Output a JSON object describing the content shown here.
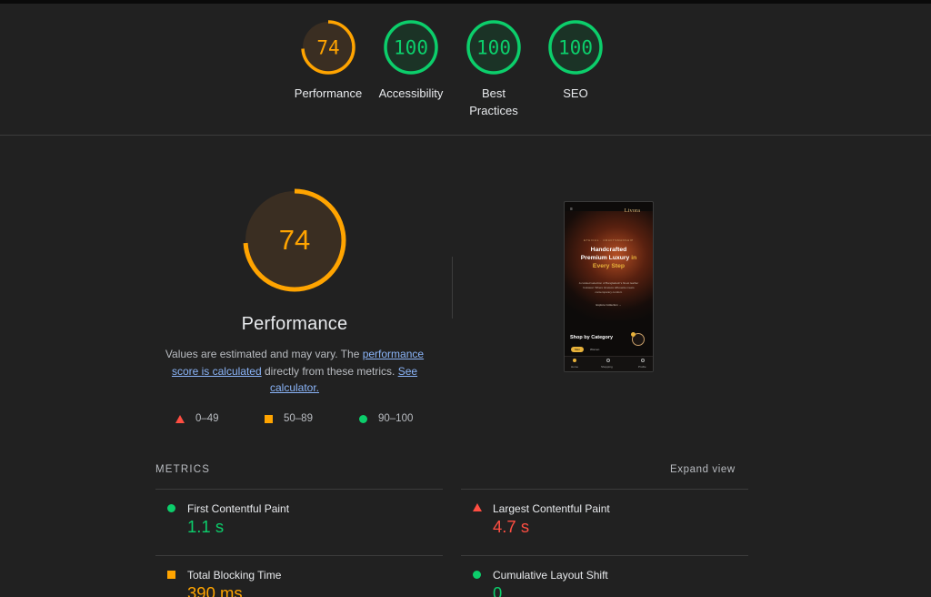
{
  "colors": {
    "pass": "#0cce6b",
    "average": "#ffa400",
    "fail": "#ff4e42",
    "link": "#8ab4f8"
  },
  "summary": [
    {
      "score": 74,
      "label": "Performance",
      "rating": "average"
    },
    {
      "score": 100,
      "label": "Accessibility",
      "rating": "pass"
    },
    {
      "score": 100,
      "label": "Best Practices",
      "rating": "pass"
    },
    {
      "score": 100,
      "label": "SEO",
      "rating": "pass"
    }
  ],
  "performance": {
    "score": 74,
    "title": "Performance",
    "desc_pre": "Values are estimated and may vary. The ",
    "desc_link1": "performance score is calculated",
    "desc_mid": " directly from these metrics. ",
    "desc_link2": "See calculator."
  },
  "legend": [
    {
      "range": "0–49",
      "rating": "fail"
    },
    {
      "range": "50–89",
      "rating": "average"
    },
    {
      "range": "90–100",
      "rating": "pass"
    }
  ],
  "screenshot": {
    "menu": "≡",
    "brand": "Livora",
    "tagline": "ETHICAL · CRAFTSMANSHIP",
    "headline_1": "Handcrafted",
    "headline_2": "Premium Luxury",
    "headline_3": "in",
    "headline_4": "Every Step",
    "subtext": "A curated selection of Bangladesh's finest leather footwear. Where timeless silhouette meets contemporary comfort.",
    "explore": "Explore Collection →",
    "category_title": "Shop by Category",
    "chip_active": "Men",
    "chip": "Women",
    "nav_home": "Home",
    "nav_shop": "Shopping",
    "nav_profile": "Profile"
  },
  "metrics": {
    "header": "METRICS",
    "expand_label": "Expand view",
    "items": [
      {
        "name": "First Contentful Paint",
        "value": "1.1 s",
        "rating": "pass"
      },
      {
        "name": "Largest Contentful Paint",
        "value": "4.7 s",
        "rating": "fail"
      },
      {
        "name": "Total Blocking Time",
        "value": "390 ms",
        "rating": "average"
      },
      {
        "name": "Cumulative Layout Shift",
        "value": "0",
        "rating": "pass"
      }
    ]
  }
}
